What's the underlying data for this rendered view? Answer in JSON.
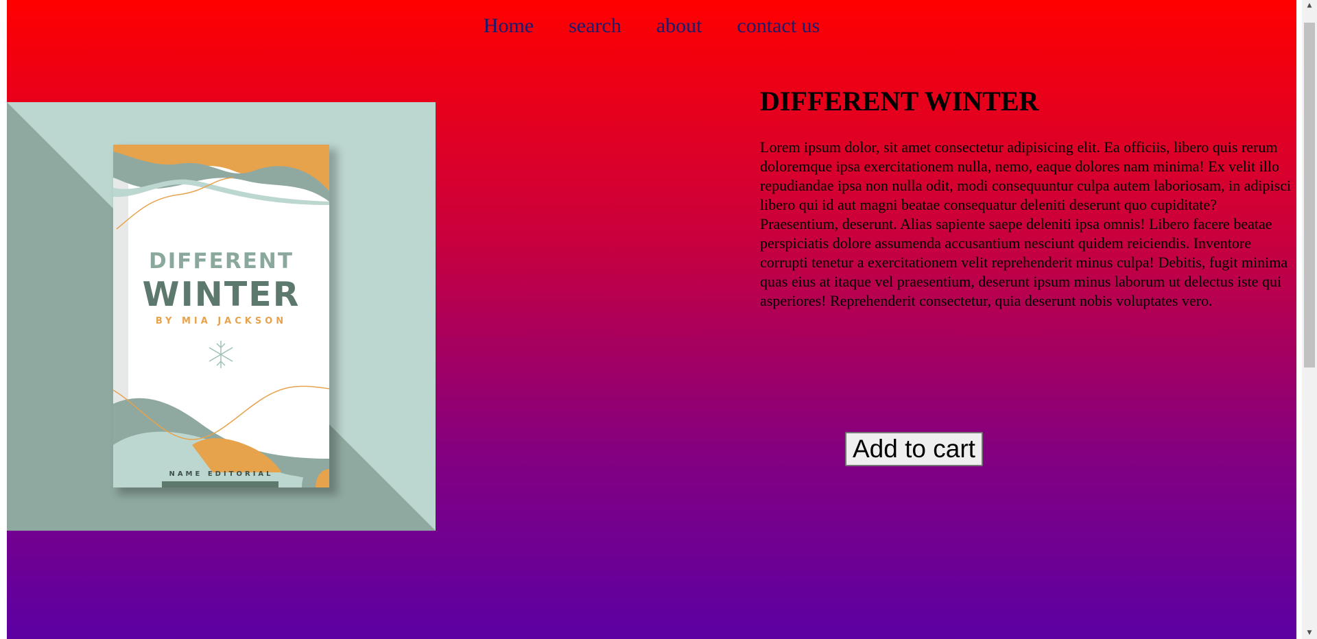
{
  "nav": {
    "items": [
      {
        "label": "Home"
      },
      {
        "label": "search"
      },
      {
        "label": "about"
      },
      {
        "label": "contact us"
      }
    ]
  },
  "cover": {
    "title_top": "DIFFERENT",
    "title_bottom": "WINTER",
    "author": "BY MIA JACKSON",
    "publisher": "NAME EDITORIAL"
  },
  "product": {
    "title": "DIFFERENT WINTER",
    "description": "Lorem ipsum dolor, sit amet consectetur adipisicing elit. Ea officiis, libero quis rerum doloremque ipsa exercitationem nulla, nemo, eaque dolores nam minima! Ex velit illo repudiandae ipsa non nulla odit, modi consequuntur culpa autem laboriosam, in adipisci libero qui id aut magni beatae consequatur deleniti deserunt quo cupiditate? Praesentium, deserunt. Alias sapiente saepe deleniti ipsa omnis! Libero facere beatae perspiciatis dolore assumenda accusantium nesciunt quidem reiciendis. Inventore corrupti tenetur a exercitationem velit reprehenderit minus culpa! Debitis, fugit minima quas eius at itaque vel praesentium, deserunt ipsum minus laborum ut delectus iste qui asperiores! Reprehenderit consectetur, quia deserunt nobis voluptates vero.",
    "add_to_cart_label": "Add to cart"
  },
  "colors": {
    "gradient_top": "#ff0000",
    "gradient_bottom": "#5c00a3",
    "cover_background": "#bcd6d0",
    "cover_accent": "#e7a24c",
    "cover_sage": "#8aa89c"
  },
  "scrollbar": {
    "up_icon": "arrow-up-icon",
    "down_icon": "arrow-down-icon"
  }
}
